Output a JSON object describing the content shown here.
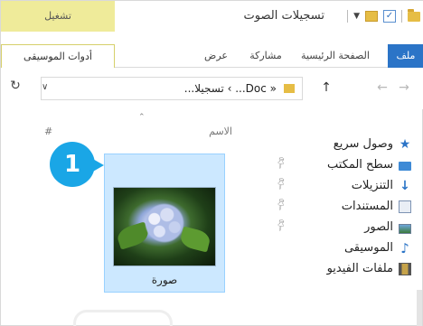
{
  "titlebar": {
    "title": "تسجيلات الصوت",
    "context_group": "تشغيل"
  },
  "ribbon": {
    "tabs": [
      {
        "label": "ملف"
      },
      {
        "label": "الصفحة الرئيسية"
      },
      {
        "label": "مشاركة"
      },
      {
        "label": "عرض"
      },
      {
        "label": "أدوات الموسيقى"
      }
    ]
  },
  "address": {
    "path": "« Doc... › تسجيلا..."
  },
  "columns": {
    "name": "الاسم",
    "number": "#"
  },
  "nav_pane": {
    "items": [
      {
        "label": "وصول سريع",
        "icon": "star-icon"
      },
      {
        "label": "سطح المكتب",
        "icon": "desktop-icon"
      },
      {
        "label": "التنزيلات",
        "icon": "download-icon"
      },
      {
        "label": "المستندات",
        "icon": "documents-icon"
      },
      {
        "label": "الصور",
        "icon": "pictures-icon"
      },
      {
        "label": "الموسيقى",
        "icon": "music-icon"
      },
      {
        "label": "ملفات الفيديو",
        "icon": "videos-icon"
      }
    ]
  },
  "file": {
    "name": "صورة"
  },
  "callout": {
    "number": "1"
  },
  "colors": {
    "accent": "#2b74c7",
    "context_tab": "#efeb9a",
    "selection": "#cce8ff",
    "callout": "#1aa6e6"
  }
}
